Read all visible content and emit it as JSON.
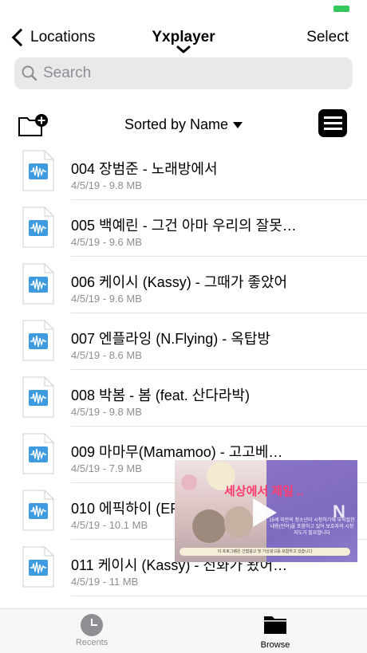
{
  "nav": {
    "back_label": "Locations",
    "title": "Yxplayer",
    "select_label": "Select"
  },
  "search": {
    "placeholder": "Search"
  },
  "toolbar": {
    "sort_label": "Sorted by Name"
  },
  "files": [
    {
      "name": "004 장범준 - 노래방에서",
      "meta": "4/5/19 - 9.8 MB"
    },
    {
      "name": "005 백예린 - 그건 아마 우리의 잘못…",
      "meta": "4/5/19 - 9.6 MB"
    },
    {
      "name": "006 케이시 (Kassy) - 그때가 좋았어",
      "meta": "4/5/19 - 9.6 MB"
    },
    {
      "name": "007 엔플라잉 (N.Flying) - 옥탑방",
      "meta": "4/5/19 - 8.6 MB"
    },
    {
      "name": "008 박봄 - 봄 (feat. 산다라박)",
      "meta": "4/5/19 - 9.8 MB"
    },
    {
      "name": "009 마마무(Mamamoo) - 고고베…",
      "meta": "4/5/19 - 7.9 MB"
    },
    {
      "name": "010 에픽하이 (EP…",
      "meta": "4/5/19 - 10.1 MB"
    },
    {
      "name": "011 케이시 (Kassy) - 전화가 왔어…",
      "meta": "4/5/19 - 11 MB"
    }
  ],
  "video": {
    "overlay_title": "세상에서 제일 ..",
    "right_text": "15세 미만의 청소년이 시청하기에 부적절한 내용(언어)을 포함하고 있어 보호자의 시청지도가 필요합니다",
    "footer_text": "이 프로그램은 간접광고 및 가상광고를 포함하고 있습니다"
  },
  "tabbar": {
    "recents_label": "Recents",
    "browse_label": "Browse"
  },
  "colors": {
    "battery": "#34c759",
    "secondary_text": "#8e8e93",
    "file_icon_blue": "#3e9be0"
  },
  "icons": [
    "chevron-left-icon",
    "chevron-down-icon",
    "search-icon",
    "folder-add-icon",
    "sort-arrow-icon",
    "list-view-icon",
    "audio-file-icon",
    "play-icon",
    "clock-icon",
    "folder-icon"
  ]
}
